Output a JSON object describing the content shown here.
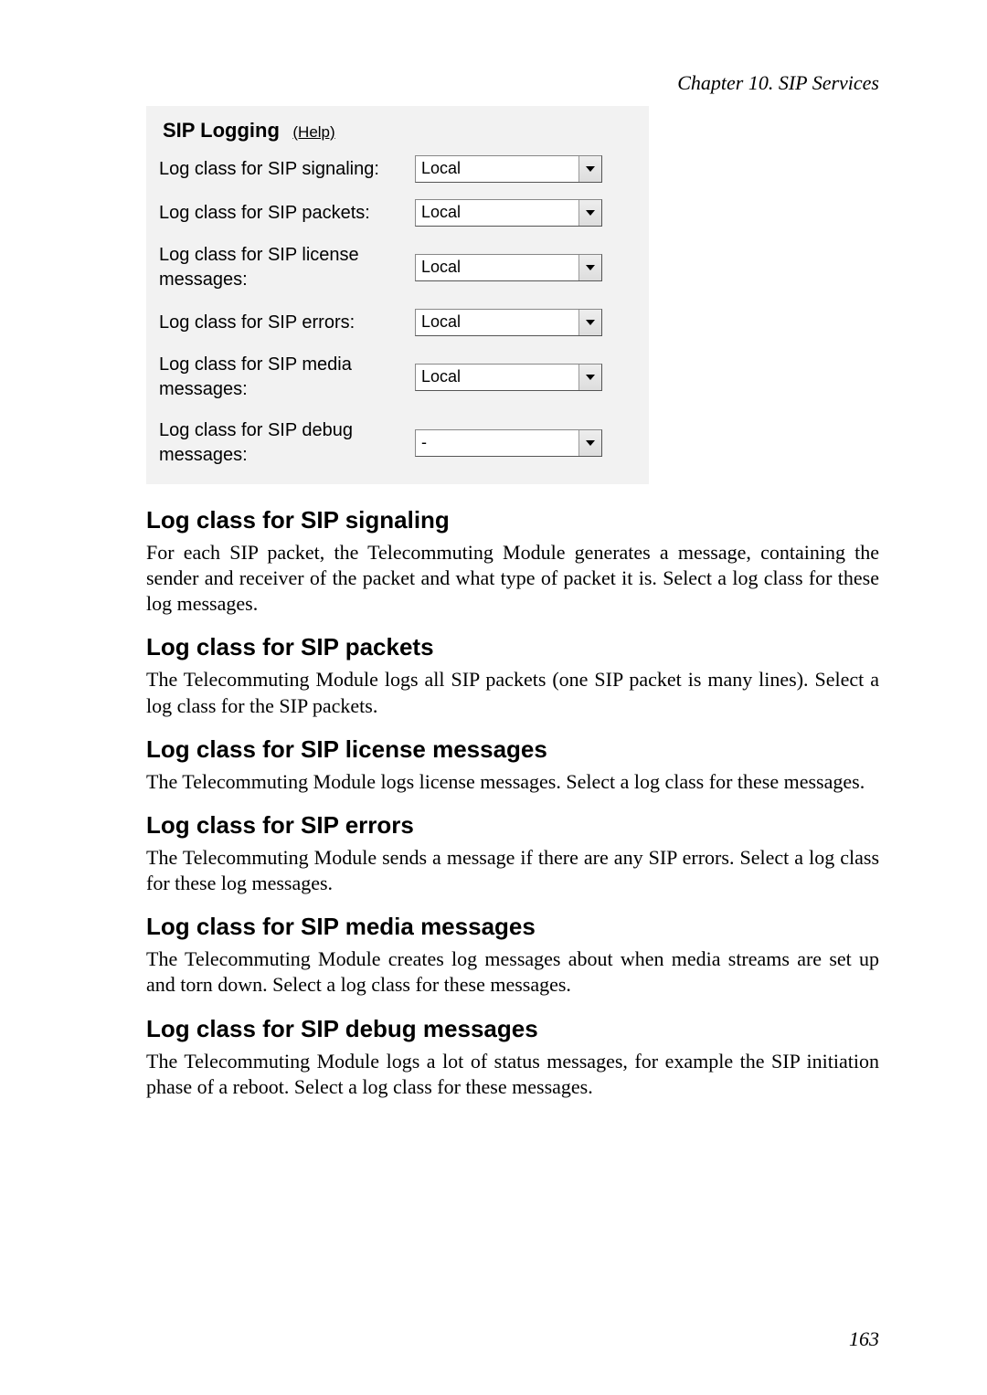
{
  "header": {
    "chapter": "Chapter 10. SIP Services"
  },
  "panel": {
    "title": "SIP Logging",
    "help_label": "(Help)",
    "rows": [
      {
        "label": "Log class for SIP signaling:",
        "value": "Local"
      },
      {
        "label": "Log class for SIP packets:",
        "value": "Local"
      },
      {
        "label": "Log class for SIP license messages:",
        "value": "Local"
      },
      {
        "label": "Log class for SIP errors:",
        "value": "Local"
      },
      {
        "label": "Log class for SIP media messages:",
        "value": "Local"
      },
      {
        "label": "Log class for SIP debug messages:",
        "value": "-"
      }
    ]
  },
  "sections": [
    {
      "heading": "Log class for SIP signaling",
      "body": "For each SIP packet, the Telecommuting Module generates a message, containing the sender and receiver of the packet and what type of packet it is. Select a log class for these log messages."
    },
    {
      "heading": "Log class for SIP packets",
      "body": "The Telecommuting Module logs all SIP packets (one SIP packet is many lines). Select a log class for the SIP packets."
    },
    {
      "heading": "Log class for SIP license messages",
      "body": "The Telecommuting Module logs license messages. Select a log class for these messages."
    },
    {
      "heading": "Log class for SIP errors",
      "body": "The Telecommuting Module sends a message if there are any SIP errors. Select a log class for these log messages."
    },
    {
      "heading": "Log class for SIP media messages",
      "body": "The Telecommuting Module creates log messages about when media streams are set up and torn down. Select a log class for these messages."
    },
    {
      "heading": "Log class for SIP debug messages",
      "body": "The Telecommuting Module logs a lot of status messages, for example the SIP initiation phase of a reboot. Select a log class for these messages."
    }
  ],
  "page_number": "163"
}
